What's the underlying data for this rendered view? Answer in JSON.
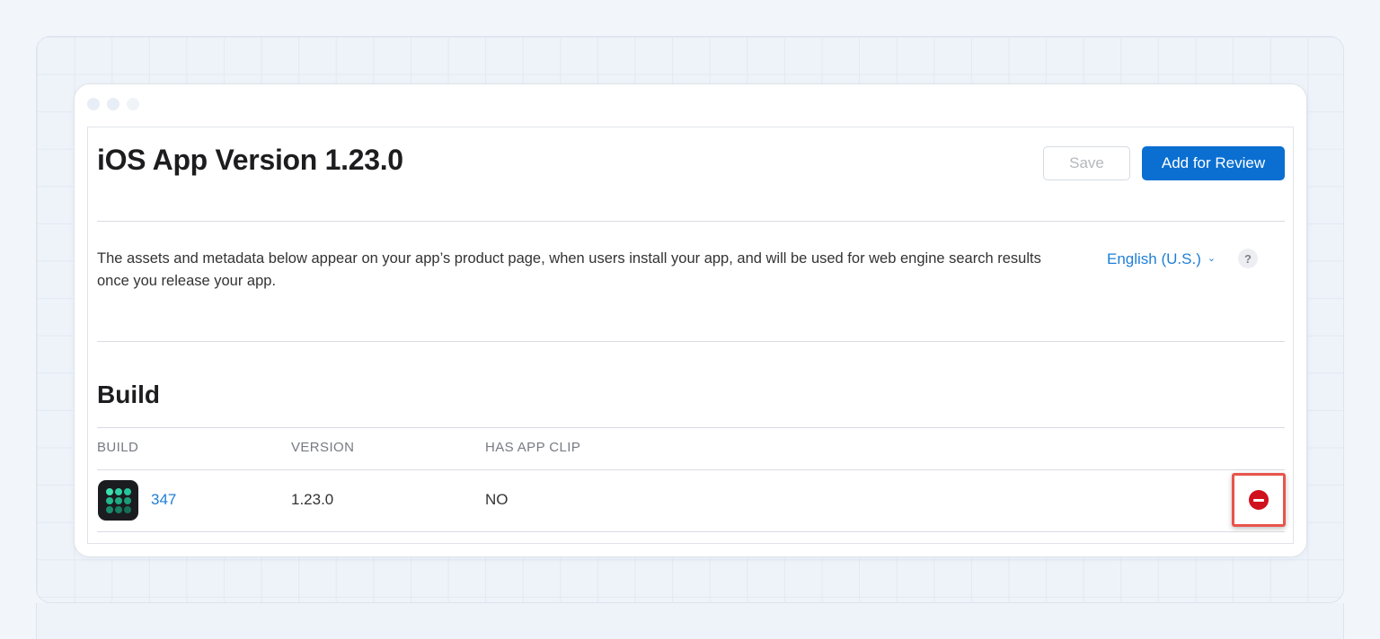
{
  "page": {
    "title": "iOS App Version 1.23.0",
    "save_label": "Save",
    "review_label": "Add for Review",
    "description": "The assets and metadata below appear on your app’s product page, when users install your app, and will be used for web engine search results once you release your app.",
    "language": "English (U.S.)",
    "language_chevron": "⌄",
    "help_glyph": "?"
  },
  "build": {
    "section_title": "Build",
    "columns": [
      "BUILD",
      "VERSION",
      "HAS APP CLIP"
    ],
    "rows": [
      {
        "build": "347",
        "version": "1.23.0",
        "has_app_clip": "NO"
      }
    ]
  },
  "icons": {
    "app_icon": "app-icon",
    "remove": "remove-icon",
    "help": "help-icon",
    "chevron": "chevron-down-icon"
  },
  "colors": {
    "accent": "#0a6fd1",
    "link": "#1f7fd6",
    "remove": "#d0101c",
    "highlight": "#e8544b"
  }
}
